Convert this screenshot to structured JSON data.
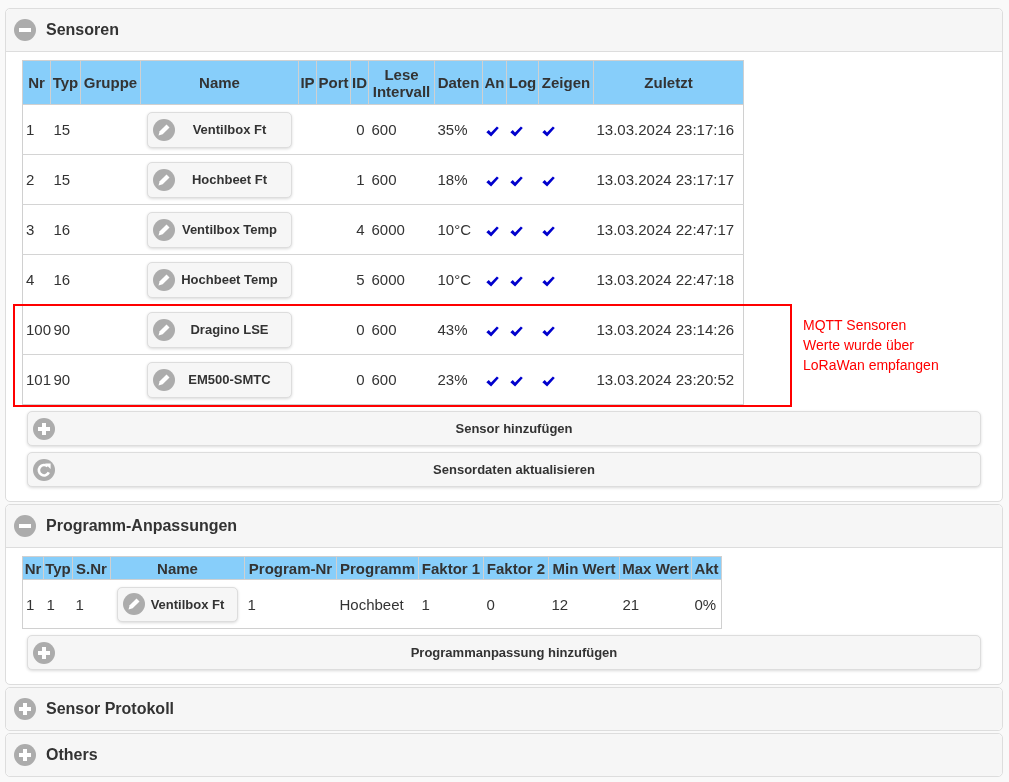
{
  "sections": [
    {
      "title": "Sensoren",
      "expanded": true,
      "table": {
        "kind": "sensors",
        "columns": [
          "Nr",
          "Typ",
          "Gruppe",
          "Name",
          "IP",
          "Port",
          "ID",
          "Lese Intervall",
          "Daten",
          "An",
          "Log",
          "Zeigen",
          "Zuletzt"
        ],
        "rows": [
          {
            "nr": "1",
            "typ": "15",
            "name": "Ventilbox Ft",
            "id": "0",
            "interval": "600",
            "data": "35%",
            "on": true,
            "log": true,
            "show": true,
            "last": "13.03.2024 23:17:16"
          },
          {
            "nr": "2",
            "typ": "15",
            "name": "Hochbeet Ft",
            "id": "1",
            "interval": "600",
            "data": "18%",
            "on": true,
            "log": true,
            "show": true,
            "last": "13.03.2024 23:17:17"
          },
          {
            "nr": "3",
            "typ": "16",
            "name": "Ventilbox Temp",
            "id": "4",
            "interval": "6000",
            "data": "10°C",
            "on": true,
            "log": true,
            "show": true,
            "last": "13.03.2024 22:47:17"
          },
          {
            "nr": "4",
            "typ": "16",
            "name": "Hochbeet Temp",
            "id": "5",
            "interval": "6000",
            "data": "10°C",
            "on": true,
            "log": true,
            "show": true,
            "last": "13.03.2024 22:47:18"
          },
          {
            "nr": "100",
            "typ": "90",
            "name": "Dragino LSE",
            "id": "0",
            "interval": "600",
            "data": "43%",
            "on": true,
            "log": true,
            "show": true,
            "last": "13.03.2024 23:14:26"
          },
          {
            "nr": "101",
            "typ": "90",
            "name": "EM500-SMTC",
            "id": "0",
            "interval": "600",
            "data": "23%",
            "on": true,
            "log": true,
            "show": true,
            "last": "13.03.2024 23:20:52"
          }
        ]
      },
      "buttons": [
        {
          "kind": "add",
          "label": "Sensor hinzufügen"
        },
        {
          "kind": "refresh",
          "label": "Sensordaten aktualisieren"
        }
      ],
      "annotation": {
        "lines": [
          "MQTT Sensoren",
          "Werte wurde über",
          "LoRaWan empfangen"
        ]
      }
    },
    {
      "title": "Programm-Anpassungen",
      "expanded": true,
      "table": {
        "kind": "programs",
        "columns": [
          "Nr",
          "Typ",
          "S.Nr",
          "Name",
          "Program-Nr",
          "Programm",
          "Faktor 1",
          "Faktor 2",
          "Min Wert",
          "Max Wert",
          "Akt"
        ],
        "rows": [
          {
            "nr": "1",
            "typ": "1",
            "snr": "1",
            "name": "Ventilbox Ft",
            "program_nr": "1",
            "program": "Hochbeet",
            "factor_1": "1",
            "factor_2": "0",
            "min": "12",
            "max": "21",
            "akt": "0%"
          }
        ]
      },
      "buttons": [
        {
          "kind": "add",
          "label": "Programmanpassung hinzufügen"
        }
      ]
    },
    {
      "title": "Sensor Protokoll",
      "expanded": false
    },
    {
      "title": "Others",
      "expanded": false
    }
  ]
}
